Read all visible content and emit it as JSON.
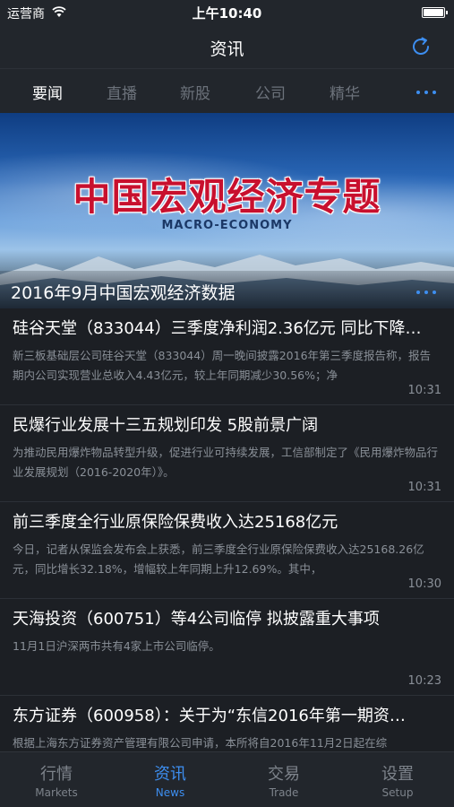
{
  "status_bar": {
    "carrier": "运营商",
    "time": "上午10:40"
  },
  "nav": {
    "title": "资讯"
  },
  "tabs": [
    {
      "label": "要闻",
      "active": true
    },
    {
      "label": "直播",
      "active": false
    },
    {
      "label": "新股",
      "active": false
    },
    {
      "label": "公司",
      "active": false
    },
    {
      "label": "精华",
      "active": false
    }
  ],
  "banner": {
    "title": "中国宏观经济专题",
    "subtitle": "MACRO-ECONOMY",
    "caption": "2016年9月中国宏观经济数据"
  },
  "news": [
    {
      "title": "硅谷天堂（833044）三季度净利润2.36亿元 同比下降…",
      "summary": "新三板基础层公司硅谷天堂（833044）周一晚间披露2016年第三季度报告称，报告期内公司实现营业总收入4.43亿元，较上年同期减少30.56%；净",
      "time": "10:31"
    },
    {
      "title": "民爆行业发展十三五规划印发 5股前景广阔",
      "summary": "为推动民用爆炸物品转型升级，促进行业可持续发展，工信部制定了《民用爆炸物品行业发展规划（2016-2020年）》。",
      "time": "10:31"
    },
    {
      "title": "前三季度全行业原保险保费收入达25168亿元",
      "summary": "今日，记者从保监会发布会上获悉，前三季度全行业原保险保费收入达25168.26亿元，同比增长32.18%，增幅较上年同期上升12.69%。其中，",
      "time": "10:30"
    },
    {
      "title": "天海投资（600751）等4公司临停 拟披露重大事项",
      "summary": "11月1日沪深两市共有4家上市公司临停。",
      "time": "10:23"
    },
    {
      "title": "东方证券（600958）：关于为“东信2016年第一期资…",
      "summary": "根据上海东方证券资产管理有限公司申请，本所将自2016年11月2日起在综",
      "time": ""
    }
  ],
  "tabbar": [
    {
      "cn": "行情",
      "en": "Markets",
      "active": false
    },
    {
      "cn": "资讯",
      "en": "News",
      "active": true
    },
    {
      "cn": "交易",
      "en": "Trade",
      "active": false
    },
    {
      "cn": "设置",
      "en": "Setup",
      "active": false
    }
  ],
  "colors": {
    "accent": "#3d8ef0",
    "background": "#1c1f24",
    "bar": "#22262c"
  }
}
